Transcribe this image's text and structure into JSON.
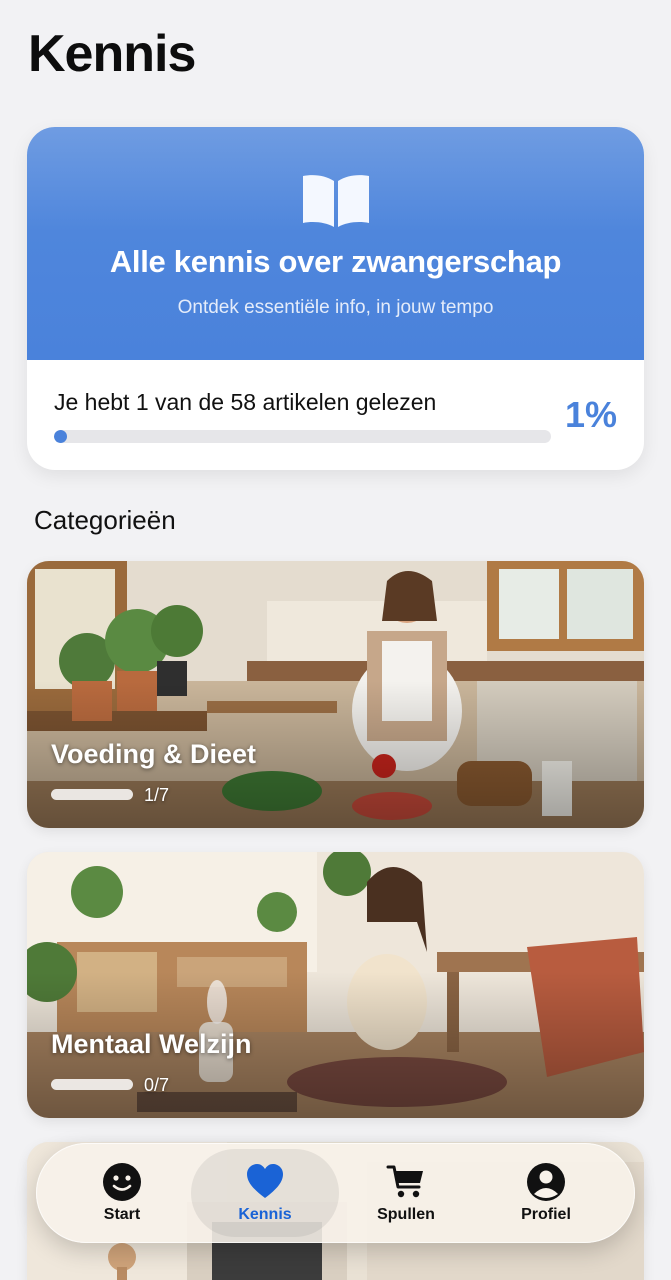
{
  "header": {
    "title": "Kennis"
  },
  "hero": {
    "icon": "book-open-icon",
    "title": "Alle kennis over zwangerschap",
    "subtitle": "Ontdek essentiële info, in jouw tempo",
    "progress_text": "Je hebt 1 van de 58 artikelen gelezen",
    "progress_percent_label": "1%",
    "progress_fraction": 0.017,
    "accent_color": "#4a82db"
  },
  "categories_section": {
    "title": "Categorieën"
  },
  "categories": [
    {
      "title": "Voeding & Dieet",
      "count": "1/7",
      "progress_fraction": 0.14
    },
    {
      "title": "Mentaal Welzijn",
      "count": "0/7",
      "progress_fraction": 0.0
    },
    {
      "title": "",
      "count": ""
    }
  ],
  "tabbar": {
    "items": [
      {
        "label": "Start",
        "icon": "smiley-icon",
        "active": false
      },
      {
        "label": "Kennis",
        "icon": "heart-icon",
        "active": true
      },
      {
        "label": "Spullen",
        "icon": "cart-icon",
        "active": false
      },
      {
        "label": "Profiel",
        "icon": "person-circle-icon",
        "active": false
      }
    ],
    "active_color": "#1a63d6"
  }
}
